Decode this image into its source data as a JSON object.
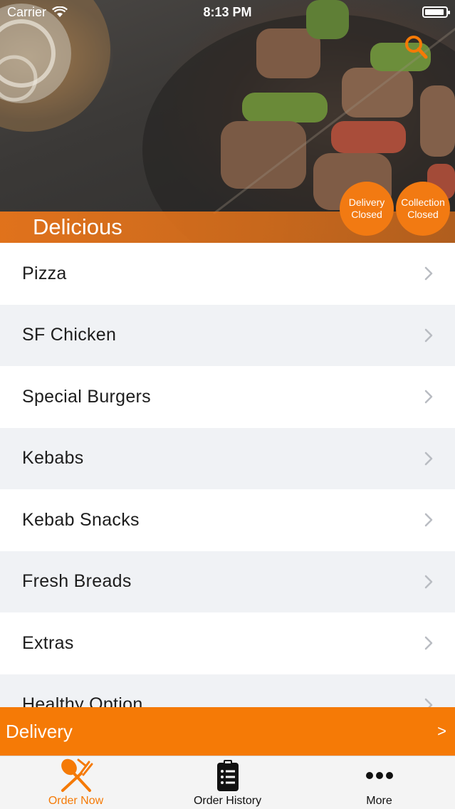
{
  "status_bar": {
    "carrier": "Carrier",
    "time": "8:13 PM"
  },
  "header": {
    "restaurant_name": "Delicious"
  },
  "badges": {
    "delivery": {
      "line1": "Delivery",
      "line2": "Closed"
    },
    "collection": {
      "line1": "Collection",
      "line2": "Closed"
    }
  },
  "menu": {
    "items": [
      {
        "label": "Pizza"
      },
      {
        "label": "SF Chicken"
      },
      {
        "label": "Special Burgers"
      },
      {
        "label": "Kebabs"
      },
      {
        "label": "Kebab Snacks"
      },
      {
        "label": "Fresh Breads"
      },
      {
        "label": "Extras"
      },
      {
        "label": "Healthy Option"
      }
    ]
  },
  "delivery_bar": {
    "label": "Delivery",
    "arrow": ">"
  },
  "tabs": [
    {
      "label": "Order Now",
      "icon": "fork-knife-icon",
      "active": true
    },
    {
      "label": "Order History",
      "icon": "clipboard-list-icon",
      "active": false
    },
    {
      "label": "More",
      "icon": "more-dots-icon",
      "active": false
    }
  ],
  "colors": {
    "accent": "#f57a06",
    "badge": "#f27a12",
    "tab_active": "#f57a06",
    "tab_inactive": "#111111"
  }
}
